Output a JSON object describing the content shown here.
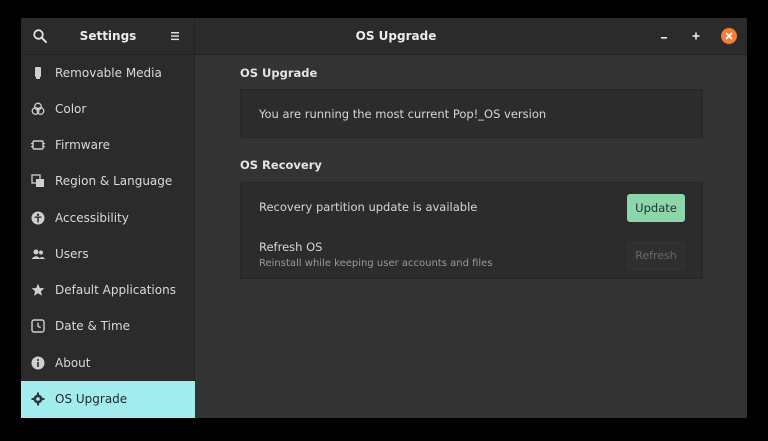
{
  "window": {
    "sidebar_title": "Settings",
    "page_title": "OS Upgrade"
  },
  "icons": {
    "search": "search-icon",
    "menu": "menu-icon",
    "minimize": "minimize-icon",
    "maximize": "maximize-icon",
    "close": "close-icon"
  },
  "colors": {
    "accent_active": "#a3ecee",
    "update_button": "#8dd5ab",
    "close_button": "#f37d35"
  },
  "sidebar": {
    "items": [
      {
        "label": "Removable Media",
        "icon": "usb-drive-icon",
        "active": false
      },
      {
        "label": "Color",
        "icon": "color-circles-icon",
        "active": false
      },
      {
        "label": "Firmware",
        "icon": "chip-icon",
        "active": false
      },
      {
        "label": "Region & Language",
        "icon": "language-icon",
        "active": false
      },
      {
        "label": "Accessibility",
        "icon": "accessibility-icon",
        "active": false
      },
      {
        "label": "Users",
        "icon": "users-icon",
        "active": false
      },
      {
        "label": "Default Applications",
        "icon": "star-icon",
        "active": false
      },
      {
        "label": "Date & Time",
        "icon": "clock-icon",
        "active": false
      },
      {
        "label": "About",
        "icon": "info-icon",
        "active": false
      },
      {
        "label": "OS Upgrade",
        "icon": "gear-icon",
        "active": true
      }
    ]
  },
  "main": {
    "upgrade": {
      "heading": "OS Upgrade",
      "status": "You are running the most current Pop!_OS version"
    },
    "recovery": {
      "heading": "OS Recovery",
      "partition_text": "Recovery partition update is available",
      "update_button": "Update",
      "refresh_title": "Refresh OS",
      "refresh_desc": "Reinstall while keeping user accounts and files",
      "refresh_button": "Refresh"
    }
  }
}
